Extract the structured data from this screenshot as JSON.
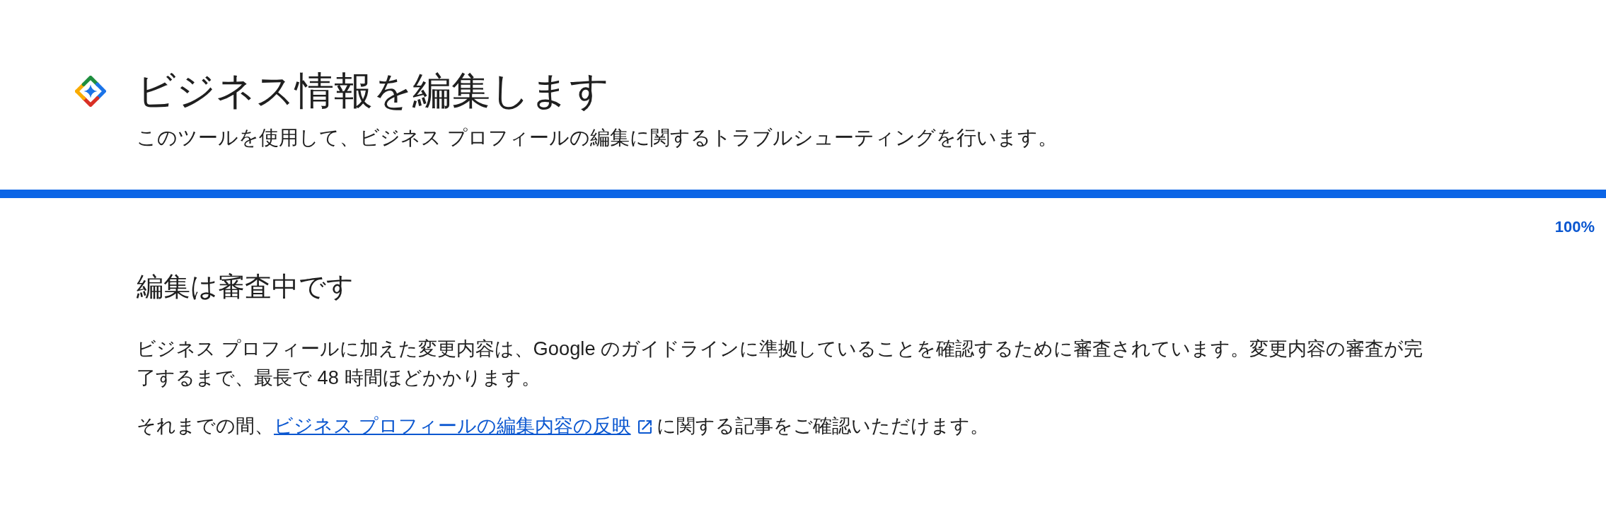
{
  "header": {
    "title": "ビジネス情報を編集します",
    "subtitle": "このツールを使用して、ビジネス プロフィールの編集に関するトラブルシューティングを行います。"
  },
  "progress": {
    "level": 1,
    "reading": "100%"
  },
  "content": {
    "heading": "編集は審査中です",
    "paragraphs": [
      [
        {
          "kind": "text",
          "text": "ビジネス プロフィールに加えた変更内容は、Google のガイドラインに準拠していることを確認するために審査されています。変更内容の審査が完了するまで、最長で 48 時間ほどかかります。"
        }
      ],
      [
        {
          "kind": "text",
          "text": "それまでの間、"
        },
        {
          "kind": "link",
          "text": "ビジネス プロフィールの編集内容の反映"
        },
        {
          "kind": "text",
          "text": " に関する記事をご確認いただけます。"
        }
      ]
    ]
  }
}
